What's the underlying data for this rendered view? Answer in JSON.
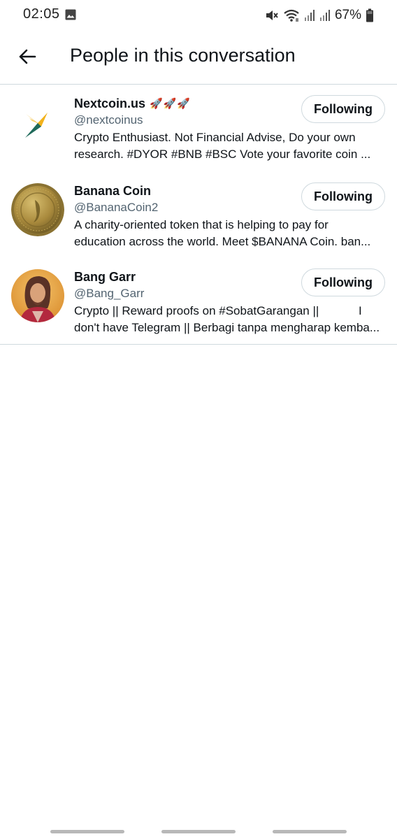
{
  "status_bar": {
    "time": "02:05",
    "battery": "67%",
    "icons": [
      "image-icon",
      "mute-icon",
      "wifi-icon",
      "signal-icon",
      "signal-icon",
      "battery-icon"
    ]
  },
  "header": {
    "title": "People in this conversation",
    "back_icon": "arrow-left-icon"
  },
  "people": [
    {
      "name": "Nextcoin.us",
      "emoji": "🚀🚀🚀",
      "handle": "@nextcoinus",
      "bio_line1": "Crypto Enthusiast. Not Financial Advise, Do your own",
      "bio_line2": "research. #DYOR #BNB #BSC Vote your favorite coin ...",
      "button": "Following",
      "avatar": "nextcoin-logo"
    },
    {
      "name": "Banana Coin",
      "emoji": "",
      "handle": "@BananaCoin2",
      "bio_line1": "A charity-oriented token that is helping to pay for",
      "bio_line2": "education across the world. Meet $BANANA Coin. ban...",
      "button": "Following",
      "avatar": "banana-coin-logo"
    },
    {
      "name": "Bang Garr",
      "emoji": "",
      "handle": "@Bang_Garr",
      "bio_line1": "Crypto || Reward proofs on #SobatGarangan ||            I",
      "bio_line2": "don't have Telegram || Berbagi tanpa mengharap kemba...",
      "button": "Following",
      "avatar": "portrait-photo"
    }
  ],
  "colors": {
    "text_primary": "#0f1419",
    "text_secondary": "#536471",
    "border": "#cfd9de"
  }
}
